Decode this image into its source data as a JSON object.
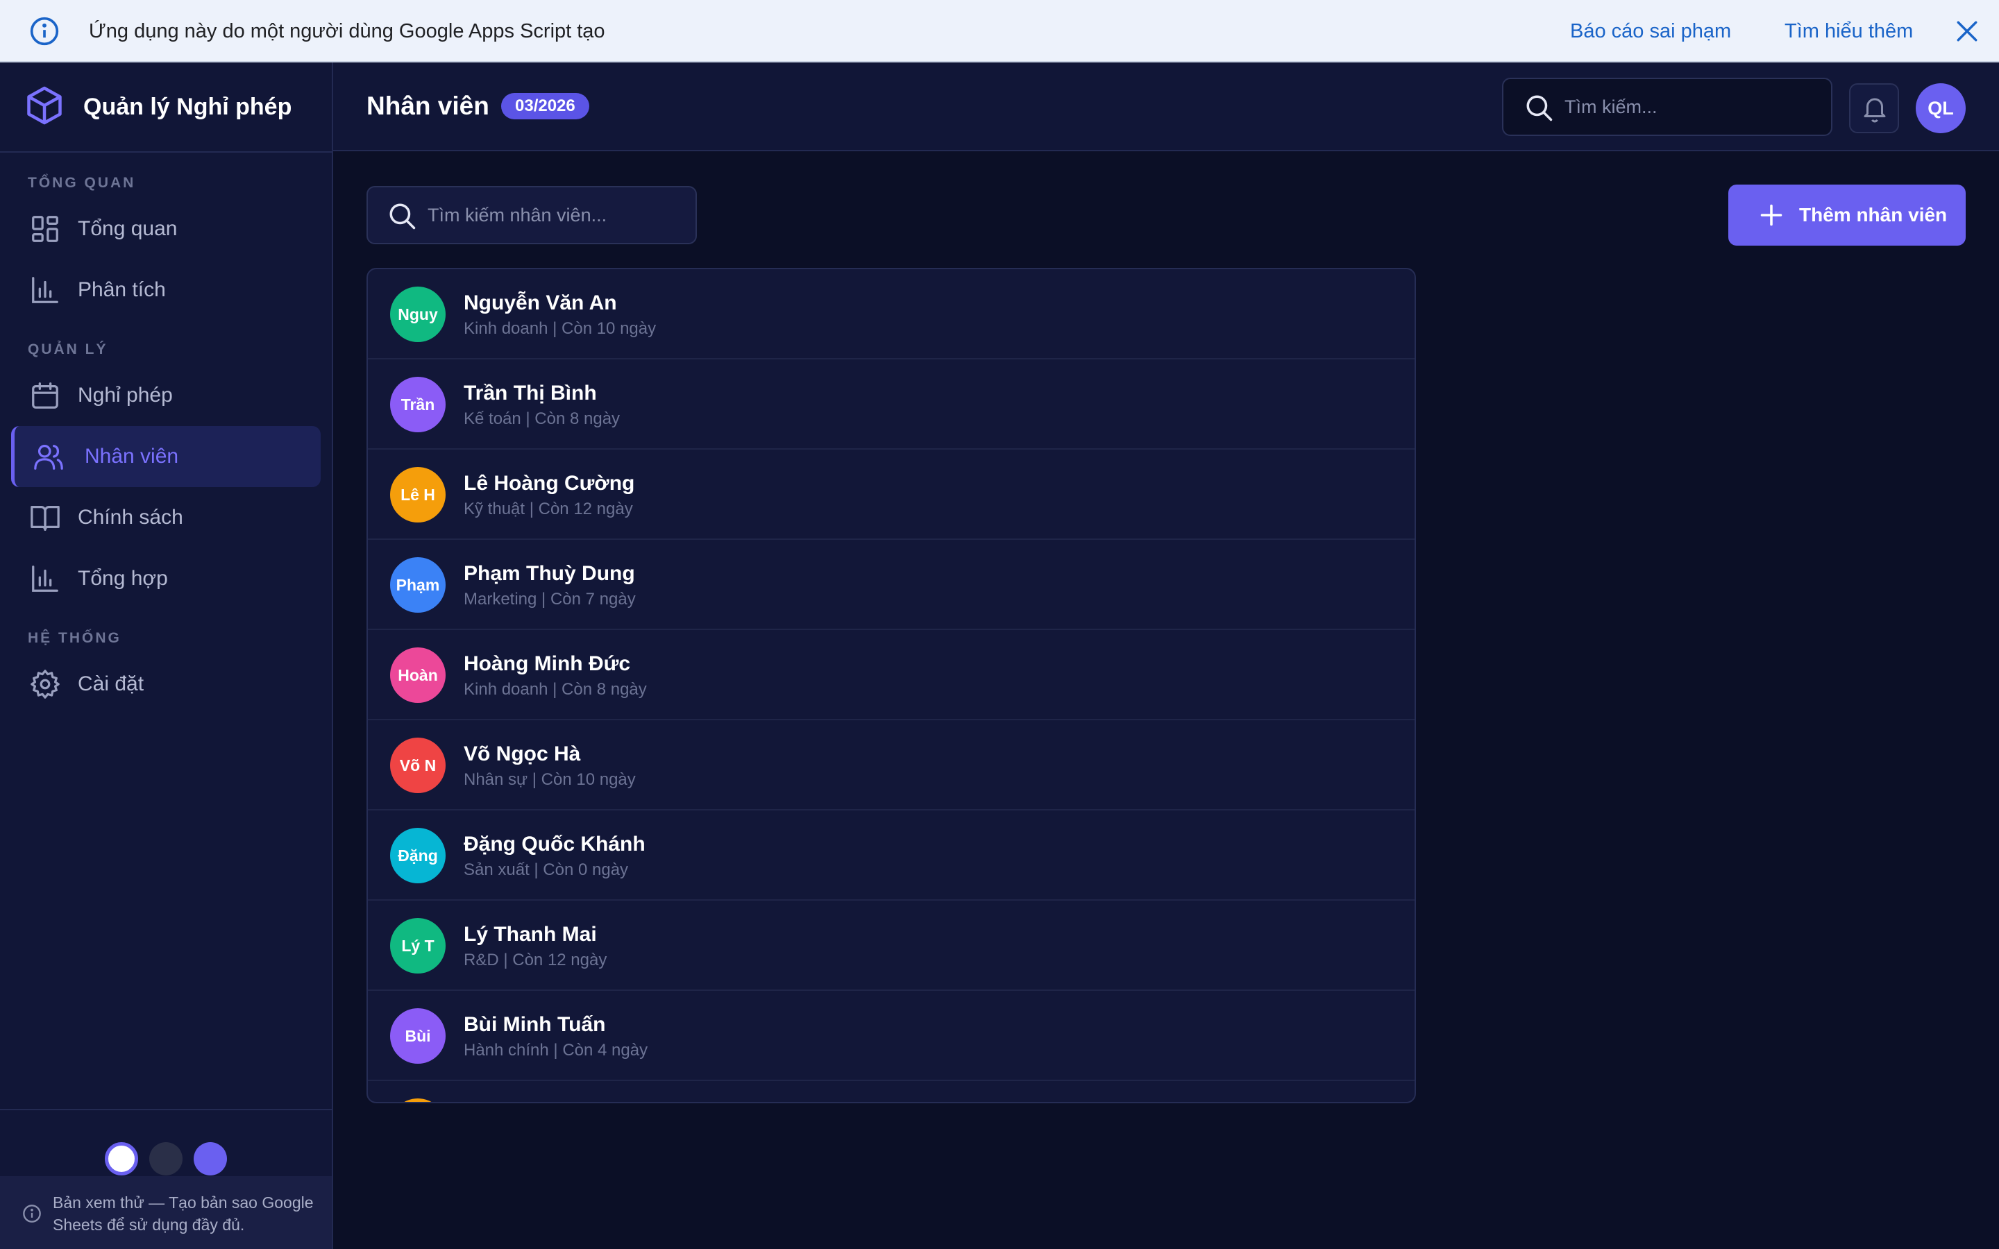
{
  "banner": {
    "message": "Ứng dụng này do một người dùng Google Apps Script tạo",
    "report_link": "Báo cáo sai phạm",
    "learn_link": "Tìm hiểu thêm"
  },
  "app": {
    "title": "Quản lý Nghỉ phép"
  },
  "sidebar": {
    "sections": [
      {
        "label": "TỔNG QUAN",
        "items": [
          {
            "label": "Tổng quan",
            "icon": "dashboard-icon"
          },
          {
            "label": "Phân tích",
            "icon": "bar-chart-icon"
          }
        ]
      },
      {
        "label": "QUẢN LÝ",
        "items": [
          {
            "label": "Nghỉ phép",
            "icon": "calendar-icon"
          },
          {
            "label": "Nhân viên",
            "icon": "users-icon",
            "active": true
          },
          {
            "label": "Chính sách",
            "icon": "book-icon"
          },
          {
            "label": "Tổng hợp",
            "icon": "bar-chart-icon"
          }
        ]
      },
      {
        "label": "HỆ THỐNG",
        "items": [
          {
            "label": "Cài đặt",
            "icon": "gear-icon"
          }
        ]
      }
    ],
    "theme_colors": [
      "#ffffff",
      "#2a2f48",
      "#6a60f0"
    ],
    "preview_note": "Bản xem thử — Tạo bản sao Google Sheets để sử dụng đầy đủ."
  },
  "header": {
    "title": "Nhân viên",
    "period": "03/2026",
    "search_placeholder": "Tìm kiếm...",
    "avatar_initials": "QL"
  },
  "main": {
    "search_placeholder": "Tìm kiếm nhân viên...",
    "add_button": "Thêm nhân viên",
    "employees": [
      {
        "initials": "Nguy",
        "name": "Nguyễn Văn An",
        "meta": "Kinh doanh | Còn 10 ngày",
        "color": "#10b981"
      },
      {
        "initials": "Trần",
        "name": "Trần Thị Bình",
        "meta": "Kế toán | Còn 8 ngày",
        "color": "#8b5cf6"
      },
      {
        "initials": "Lê H",
        "name": "Lê Hoàng Cường",
        "meta": "Kỹ thuật | Còn 12 ngày",
        "color": "#f59e0b"
      },
      {
        "initials": "Phạm",
        "name": "Phạm Thuỳ Dung",
        "meta": "Marketing | Còn 7 ngày",
        "color": "#3b82f6"
      },
      {
        "initials": "Hoàn",
        "name": "Hoàng Minh Đức",
        "meta": "Kinh doanh | Còn 8 ngày",
        "color": "#ec4899"
      },
      {
        "initials": "Võ N",
        "name": "Võ Ngọc Hà",
        "meta": "Nhân sự | Còn 10 ngày",
        "color": "#ef4444"
      },
      {
        "initials": "Đặng",
        "name": "Đặng Quốc Khánh",
        "meta": "Sản xuất | Còn 0 ngày",
        "color": "#06b6d4"
      },
      {
        "initials": "Lý T",
        "name": "Lý Thanh Mai",
        "meta": "R&D | Còn 12 ngày",
        "color": "#10b981"
      },
      {
        "initials": "Bùi",
        "name": "Bùi Minh Tuấn",
        "meta": "Hành chính | Còn 4 ngày",
        "color": "#8b5cf6"
      },
      {
        "initials": "",
        "name": "",
        "meta": "",
        "color": "#f59e0b"
      }
    ]
  },
  "colors": {
    "accent": "#6a60f0",
    "background": "#0b0f26",
    "sidebar": "#111637"
  }
}
